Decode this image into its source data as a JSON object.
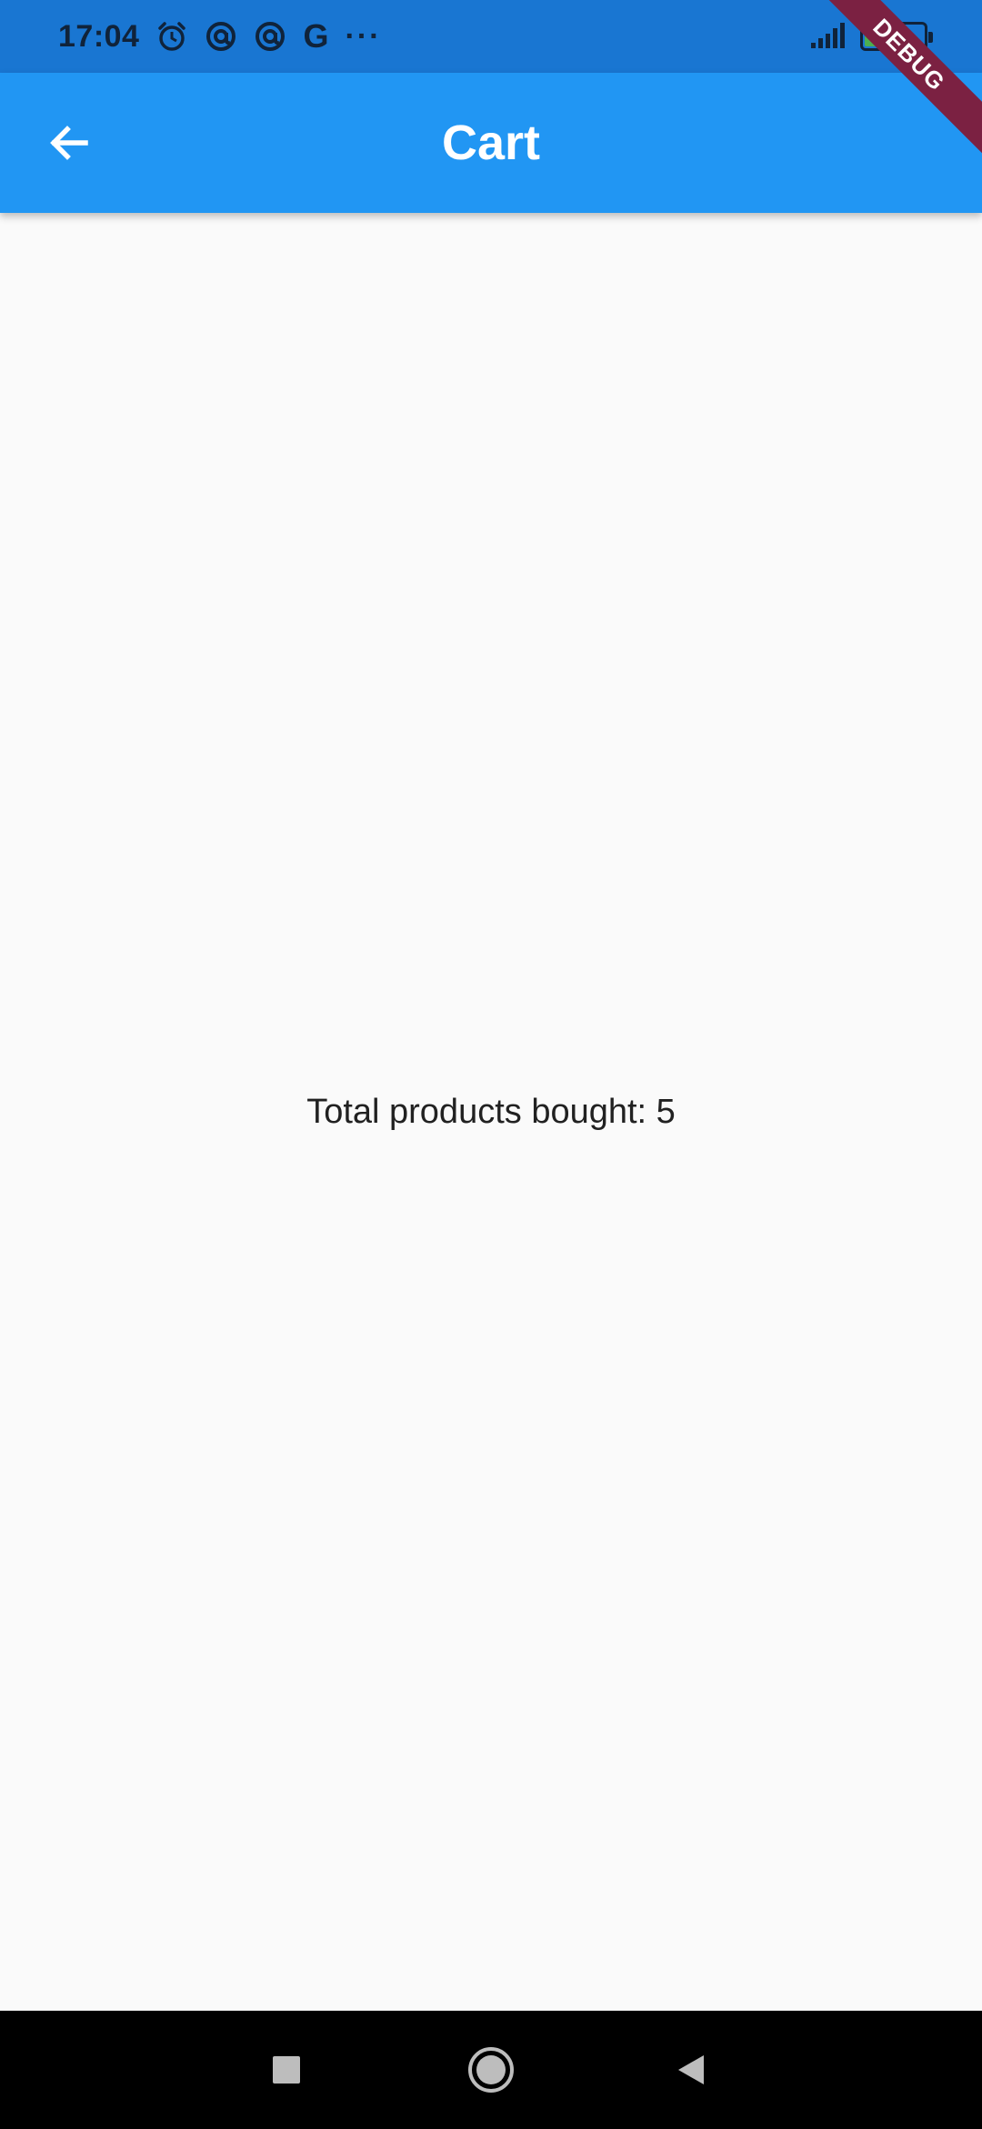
{
  "status_bar": {
    "time": "17:04",
    "battery_level": "33",
    "icons": [
      "alarm-icon",
      "at-sign-icon",
      "at-sign-icon",
      "google-icon",
      "more-dots-icon",
      "signal-icon",
      "battery-icon"
    ],
    "google_letter": "G",
    "dots": "···"
  },
  "app_bar": {
    "title": "Cart",
    "background": "#2196f3"
  },
  "debug_banner": {
    "label": "DEBUG"
  },
  "body": {
    "total_text": "Total products bought: 5"
  },
  "nav_bar": {
    "buttons": [
      "recents-icon",
      "home-icon",
      "back-icon"
    ]
  }
}
